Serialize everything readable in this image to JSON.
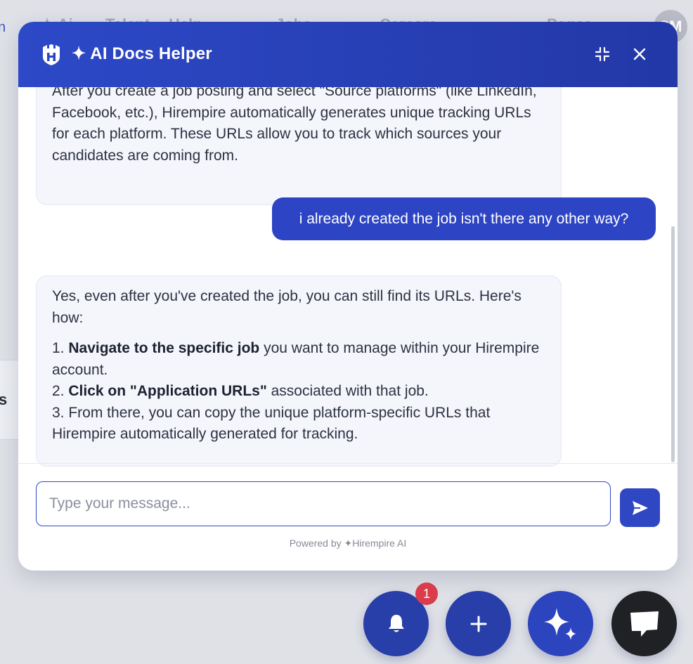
{
  "background": {
    "nav_fragments": [
      "✦ Ai",
      "Talent",
      "Help",
      "Jobs",
      "Careers",
      "Pages"
    ],
    "avatar_initials": "SM",
    "left_letter": "n",
    "card_letter": "s"
  },
  "chat": {
    "title": "✦ AI Docs Helper",
    "messages": {
      "bot1": "After you create a job posting and select \"Source platforms\" (like LinkedIn, Facebook, etc.), Hirempire automatically generates unique tracking URLs for each platform. These URLs allow you to track which sources your candidates are coming from.",
      "user1": "i already created the job isn't there any other way?",
      "bot2": {
        "intro": "Yes, even after you've created the job, you can still find its URLs. Here's how:",
        "step1_num": "1. ",
        "step1_bold": "Navigate to the specific job",
        "step1_rest": " you want to manage within your Hirempire account.",
        "step2_num": "2. ",
        "step2_bold": "Click on \"Application URLs\"",
        "step2_rest": " associated with that job.",
        "step3": "3. From there, you can copy the unique platform-specific URLs that Hirempire automatically generated for tracking."
      }
    },
    "input": {
      "placeholder": "Type your message...",
      "value": ""
    },
    "powered_by": "Powered by ✦Hirempire AI"
  },
  "fabs": {
    "notification_count": "1"
  },
  "colors": {
    "brand_blue": "#2d44c4",
    "header_gradient_start": "#2d49c7",
    "header_gradient_end": "#2338a7",
    "badge_red": "#d93c4a",
    "bot_bubble_bg": "#f4f6fc"
  },
  "icons": [
    "logo-icon",
    "minimize-icon",
    "close-icon",
    "send-icon",
    "bell-icon",
    "plus-icon",
    "sparkle-icon",
    "chat-icon"
  ]
}
